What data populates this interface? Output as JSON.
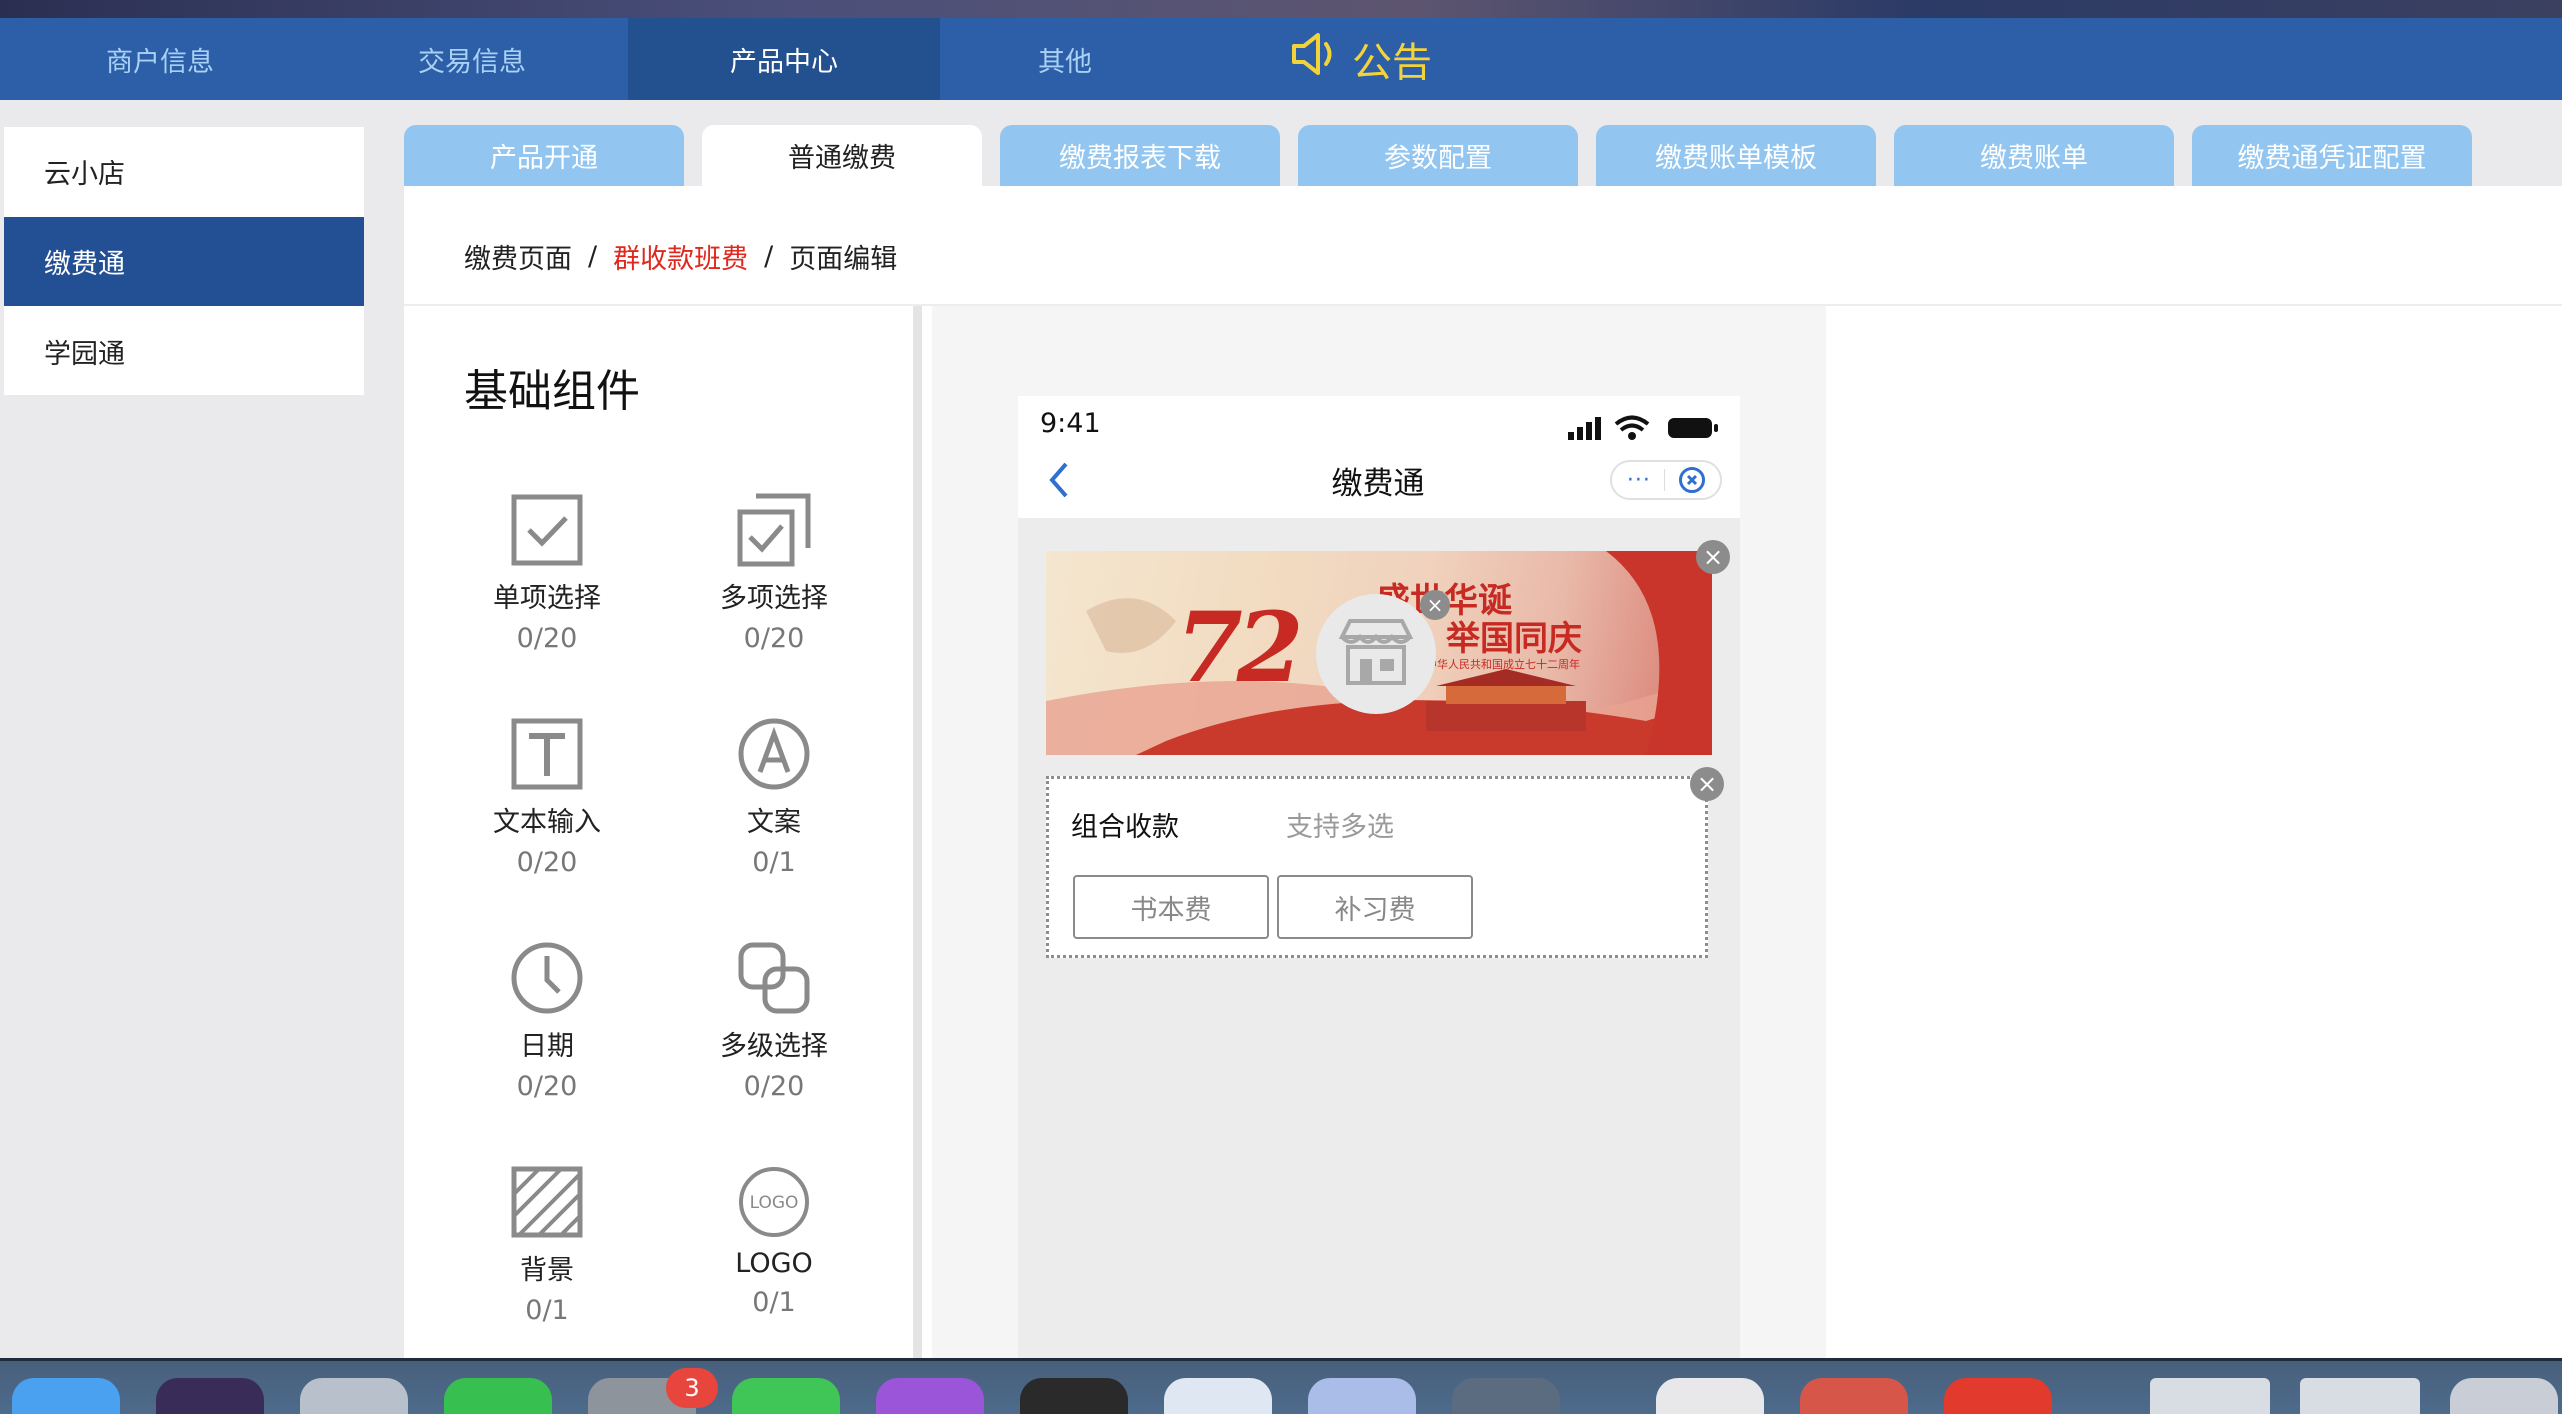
{
  "top_nav": {
    "items": [
      {
        "label": "商户信息",
        "active": false
      },
      {
        "label": "交易信息",
        "active": false
      },
      {
        "label": "产品中心",
        "active": true
      },
      {
        "label": "其他",
        "active": false
      }
    ],
    "notice_label": "公告",
    "notice_icon": "speaker-icon"
  },
  "sidebar": {
    "items": [
      {
        "label": "云小店",
        "active": false
      },
      {
        "label": "缴费通",
        "active": true
      },
      {
        "label": "学园通",
        "active": false
      }
    ]
  },
  "tabs": [
    {
      "label": "产品开通",
      "active": false
    },
    {
      "label": "普通缴费",
      "active": true
    },
    {
      "label": "缴费报表下载",
      "active": false
    },
    {
      "label": "参数配置",
      "active": false
    },
    {
      "label": "缴费账单模板",
      "active": false
    },
    {
      "label": "缴费账单",
      "active": false
    },
    {
      "label": "缴费通凭证配置",
      "active": false
    }
  ],
  "breadcrumb": {
    "root": "缴费页面",
    "separator": "/",
    "middle": "群收款班费",
    "current": "页面编辑"
  },
  "components": {
    "title": "基础组件",
    "items": [
      {
        "label": "单项选择",
        "count": "0/20",
        "icon": "single-select-icon"
      },
      {
        "label": "多项选择",
        "count": "0/20",
        "icon": "multi-select-icon"
      },
      {
        "label": "文本输入",
        "count": "0/20",
        "icon": "text-input-icon"
      },
      {
        "label": "文案",
        "count": "0/1",
        "icon": "copywriting-icon"
      },
      {
        "label": "日期",
        "count": "0/20",
        "icon": "clock-icon"
      },
      {
        "label": "多级选择",
        "count": "0/20",
        "icon": "linked-select-icon"
      },
      {
        "label": "背景",
        "count": "0/1",
        "icon": "background-icon"
      },
      {
        "label": "LOGO",
        "count": "0/1",
        "icon": "logo-icon"
      }
    ]
  },
  "phone": {
    "time": "9:41",
    "title": "缴费通",
    "capsule_dots": "···"
  },
  "banner": {
    "headline_line1": "盛世华诞",
    "headline_line2": "举国同庆",
    "subline": "中华人民共和国成立七十二周年",
    "number": "72"
  },
  "combo": {
    "title": "组合收款",
    "hint": "支持多选",
    "options": [
      "书本费",
      "补习费"
    ]
  },
  "dock": {
    "badge_count": "3"
  },
  "colors": {
    "nav_bg": "#2c5fa8",
    "nav_active": "#23508f",
    "sidebar_active": "#234f95",
    "tab_inactive": "#92c6f0",
    "notice_yellow": "#f3d33a",
    "breadcrumb_red": "#e0281e"
  }
}
